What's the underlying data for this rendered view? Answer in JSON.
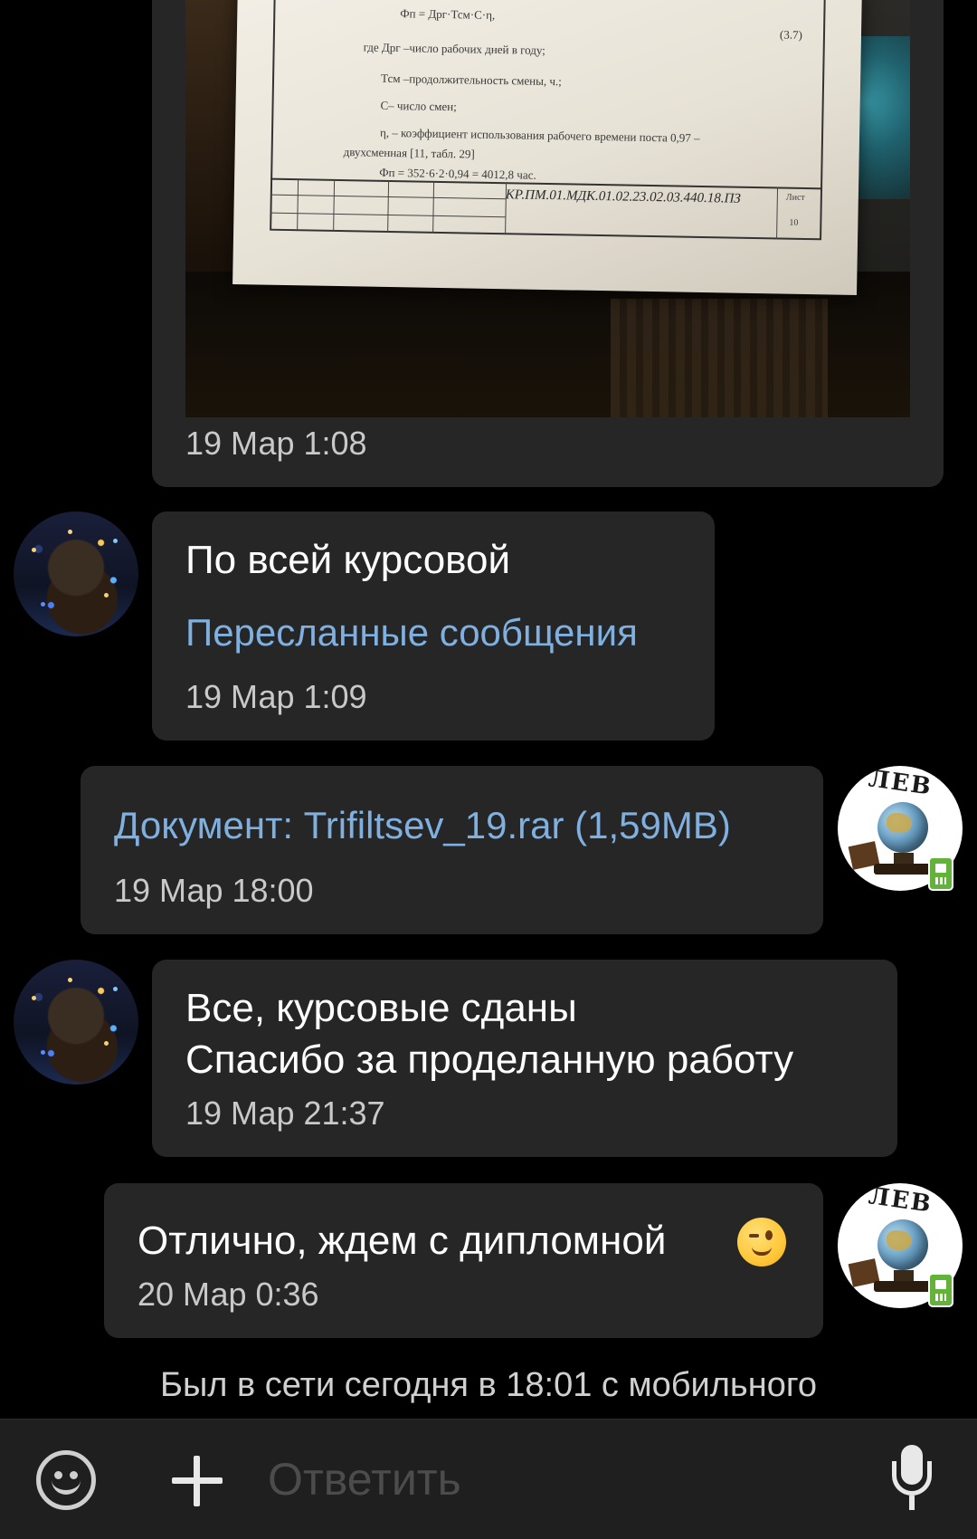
{
  "messages": [
    {
      "id": "photo",
      "time": "19 Мар 1:08",
      "photo": {
        "formula_line": "Фп = Дрг·Тсм·С·η,",
        "formula_num": "(3.7)",
        "where_line": "где Дрг –число рабочих дней в году;",
        "tsm_line": "Тсм –продолжительность смены, ч.;",
        "c_line": "С– число смен;",
        "eta_line": "η, – коэффициент использования рабочего времени поста 0,97 –",
        "shift_line": "двухсменная [11, табл. 29]",
        "calc_line": "Фп = 352·6·2·0,94 = 4012,8 час.",
        "doc_code": "КР.ПМ.01.МДК.01.02.23.02.03.440.18.ПЗ",
        "sheet_label": "Лист",
        "sheet_num": "10"
      }
    },
    {
      "id": "m1",
      "text": "По всей курсовой",
      "link": "Пересланные сообщения",
      "time": "19 Мар 1:09"
    },
    {
      "id": "m2",
      "link": "Документ: Trifiltsev_19.rar (1,59MB)",
      "time": "19 Мар 18:00"
    },
    {
      "id": "m3",
      "line1": "Все, курсовые сданы",
      "line2": "Спасибо за проделанную работу",
      "time": "19 Мар 21:37"
    },
    {
      "id": "m4",
      "text": "Отлично, ждем с дипломной",
      "time": "20 Мар 0:36"
    }
  ],
  "avatar_globe_text": "ЛЕВ",
  "status": "Был в сети сегодня в 18:01 с мобильного",
  "composer": {
    "placeholder": "Ответить"
  },
  "icons": {
    "emoji": "smile-icon",
    "attach": "plus-icon",
    "voice": "mic-icon",
    "wink": "winking-face-emoji"
  }
}
